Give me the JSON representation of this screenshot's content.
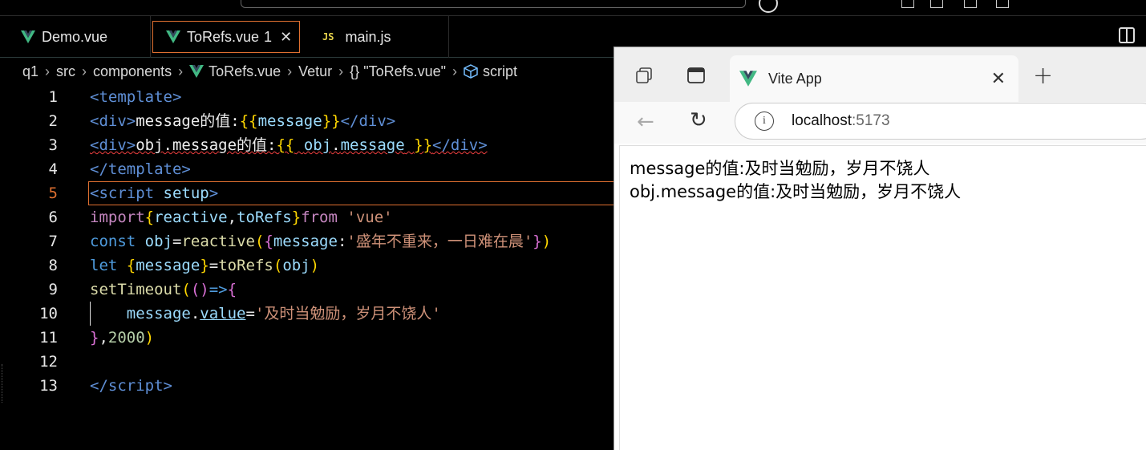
{
  "editor": {
    "tabs": [
      {
        "label": "Demo.vue",
        "icon": "vue-icon"
      },
      {
        "label": "ToRefs.vue",
        "problems": "1",
        "icon": "vue-icon",
        "active": true
      },
      {
        "label": "main.js",
        "icon": "js-icon",
        "icon_text": "JS"
      }
    ],
    "breadcrumb": {
      "items": [
        "q1",
        "src",
        "components",
        "ToRefs.vue",
        "Vetur",
        "{} \"ToRefs.vue\"",
        "script"
      ]
    },
    "current_line": 5,
    "lines": [
      {
        "n": "1",
        "html": "<span class=\"tg\">&lt;template&gt;</span>"
      },
      {
        "n": "2",
        "html": "<span class=\"tg\">&lt;div&gt;</span><span class=\"tx\">message的值:</span><span class=\"br1\">{{</span><span class=\"vr\">message</span><span class=\"br1\">}}</span><span class=\"tg\">&lt;/div&gt;</span>"
      },
      {
        "n": "3",
        "html": "<span class=\"squiggle\"><span class=\"tg\">&lt;div&gt;</span><span class=\"tx\">obj.message的值:</span><span class=\"br1\">{{</span> <span class=\"vr\">obj</span><span class=\"tx\">.</span><span class=\"vr\">message</span> <span class=\"br1\">}}</span><span class=\"tg\">&lt;/div&gt;</span></span>"
      },
      {
        "n": "4",
        "html": "<span class=\"tg\">&lt;/template&gt;</span>"
      },
      {
        "n": "5",
        "html": "<span class=\"tg\">&lt;script</span> <span class=\"vr\">setup</span><span class=\"tg\">&gt;</span>"
      },
      {
        "n": "6",
        "html": "<span class=\"kp\">import</span><span class=\"br1\">{</span><span class=\"vr\">reactive</span><span class=\"op\">,</span><span class=\"vr\">toRefs</span><span class=\"br1\">}</span><span class=\"kp\">from</span> <span class=\"st\">'vue'</span>"
      },
      {
        "n": "7",
        "html": "<span class=\"kw\">const</span> <span class=\"vr\">obj</span><span class=\"op\">=</span><span class=\"fn\">reactive</span><span class=\"br1\">(</span><span class=\"br2\">{</span><span class=\"vr\">message</span><span class=\"op\">:</span><span class=\"st\">'盛年不重来，一日难在晨'</span><span class=\"br2\">}</span><span class=\"br1\">)</span>"
      },
      {
        "n": "8",
        "html": "<span class=\"kw\">let</span> <span class=\"br1\">{</span><span class=\"vr\">message</span><span class=\"br1\">}</span><span class=\"op\">=</span><span class=\"fn\">toRefs</span><span class=\"br1\">(</span><span class=\"vr\">obj</span><span class=\"br1\">)</span>"
      },
      {
        "n": "9",
        "html": "<span class=\"fn\">setTimeout</span><span class=\"br1\">(</span><span class=\"br2\">()</span><span class=\"kw\">=&gt;</span><span class=\"br2\">{</span>"
      },
      {
        "n": "10",
        "html": "    <span class=\"vr\">message</span><span class=\"op\">.</span><span class=\"vr ul\">value</span><span class=\"op\">=</span><span class=\"st\">'及时当勉励，岁月不饶人'</span>",
        "guide": true
      },
      {
        "n": "11",
        "html": "<span class=\"br2\">}</span><span class=\"op\">,</span><span class=\"nm\">2000</span><span class=\"br1\">)</span>"
      },
      {
        "n": "12",
        "html": ""
      },
      {
        "n": "13",
        "html": "<span class=\"tg\">&lt;/script&gt;</span>"
      }
    ]
  },
  "browser": {
    "tab_title": "Vite App",
    "url_host": "localhost",
    "url_port": ":5173",
    "content": [
      "message的值:及时当勉励，岁月不饶人",
      "obj.message的值:及时当勉励，岁月不饶人"
    ]
  },
  "colors": {
    "accent": "#e07030",
    "vue_green": "#41b883",
    "vue_dark": "#35495e"
  }
}
